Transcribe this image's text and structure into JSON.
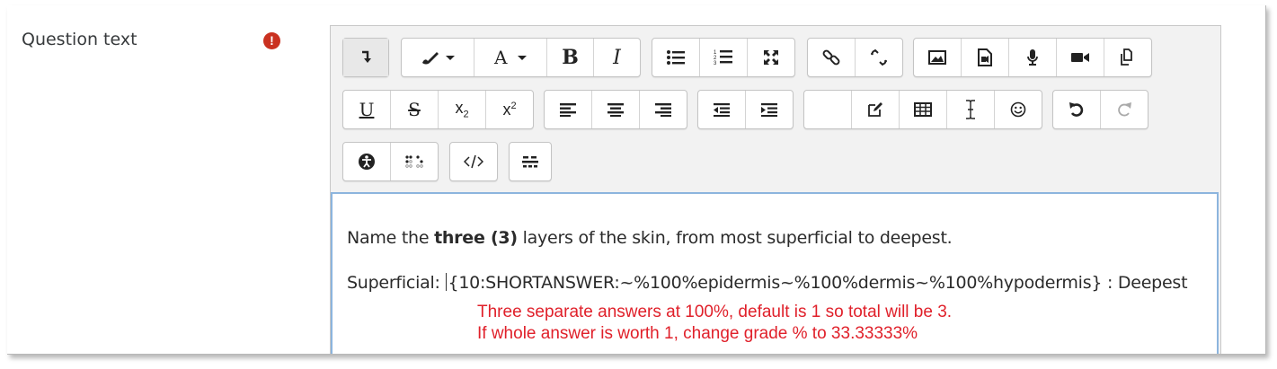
{
  "field": {
    "label": "Question text",
    "required_symbol": "!"
  },
  "toolbar": {
    "row1": {
      "g1": [
        {
          "name": "collapse-toggle-icon",
          "title": "Show more buttons",
          "active": true
        }
      ],
      "g2": [
        {
          "name": "text-style-icon"
        },
        {
          "name": "font-color-icon"
        },
        {
          "name": "bold-icon",
          "text": "B"
        },
        {
          "name": "italic-icon",
          "text": "I"
        }
      ],
      "g3": [
        {
          "name": "unordered-list-icon"
        },
        {
          "name": "ordered-list-icon"
        },
        {
          "name": "fullscreen-icon"
        }
      ],
      "g4": [
        {
          "name": "link-icon"
        },
        {
          "name": "unlink-icon"
        }
      ],
      "g5": [
        {
          "name": "image-icon"
        },
        {
          "name": "media-icon"
        },
        {
          "name": "microphone-icon"
        },
        {
          "name": "video-icon"
        },
        {
          "name": "manage-files-icon"
        }
      ]
    },
    "row2": {
      "underline_text": "U",
      "strike_text": "S",
      "subscript_text": "x",
      "subscript_sub": "2",
      "superscript_text": "x",
      "superscript_sup": "2"
    }
  },
  "content": {
    "line1_prefix": "Name the ",
    "line1_bold": "three (3)",
    "line1_suffix": " layers of the skin, from most superficial to deepest.",
    "line2_prefix": "Superficial: ",
    "line2_code": "{10:SHORTANSWER:~%100%epidermis~%100%dermis~%100%hypodermis} : Deepest"
  },
  "annotation": {
    "line1": "Three separate answers at 100%, default is 1 so total will be 3.",
    "line2": "If whole answer is worth 1, change grade % to 33.33333%",
    "color": "#e0202a"
  }
}
